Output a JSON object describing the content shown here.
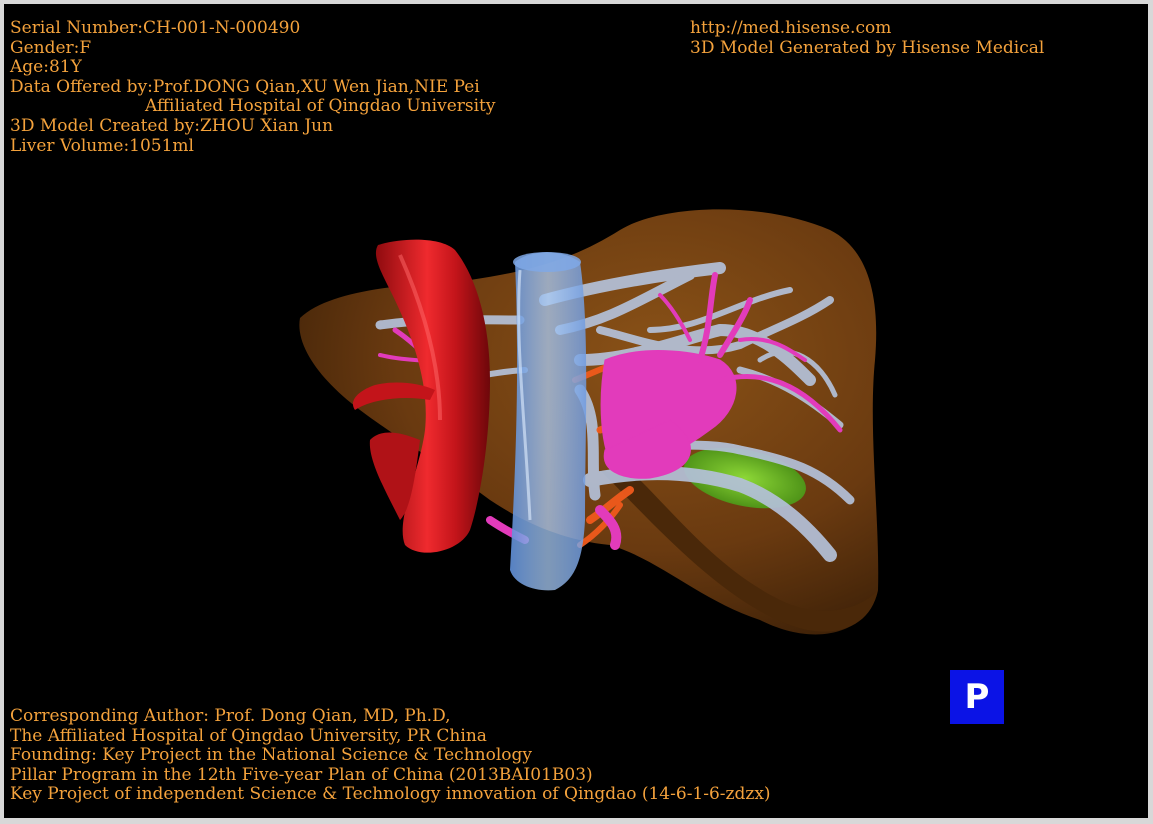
{
  "header_left": {
    "serial": "Serial Number:CH-001-N-000490",
    "gender": "Gender:F",
    "age": "Age:81Y",
    "data_offered": "Data Offered by:Prof.DONG Qian,XU Wen Jian,NIE Pei",
    "hospital": "Affiliated Hospital of Qingdao University",
    "model_created": "3D Model Created by:ZHOU Xian Jun",
    "liver_volume": "Liver Volume:1051ml"
  },
  "header_right": {
    "url": "http://med.hisense.com",
    "generated_by": "3D Model Generated by Hisense Medical"
  },
  "footer": {
    "line1": "Corresponding Author: Prof. Dong Qian, MD, Ph.D,",
    "line2": "The Affiliated Hospital of Qingdao University, PR China",
    "line3": "Founding: Key Project in the National Science & Technology",
    "line4": "Pillar Program in the 12th Five-year Plan of China (2013BAI01B03)",
    "line5": "Key Project of independent Science & Technology innovation of Qingdao (14-6-1-6-zdzx)"
  },
  "view_badge": {
    "label": "P",
    "color": "#0b13e6"
  },
  "model_colors": {
    "liver": "#6e3d0f",
    "aorta": "#d8171d",
    "vena_cava": "#8fb8ef",
    "portal_vein": "#b4c1d9",
    "hepatic_artery_branches": "#e23bbb",
    "arteries_orange": "#f05a1c",
    "gallbladder": "#5fbe1c"
  }
}
